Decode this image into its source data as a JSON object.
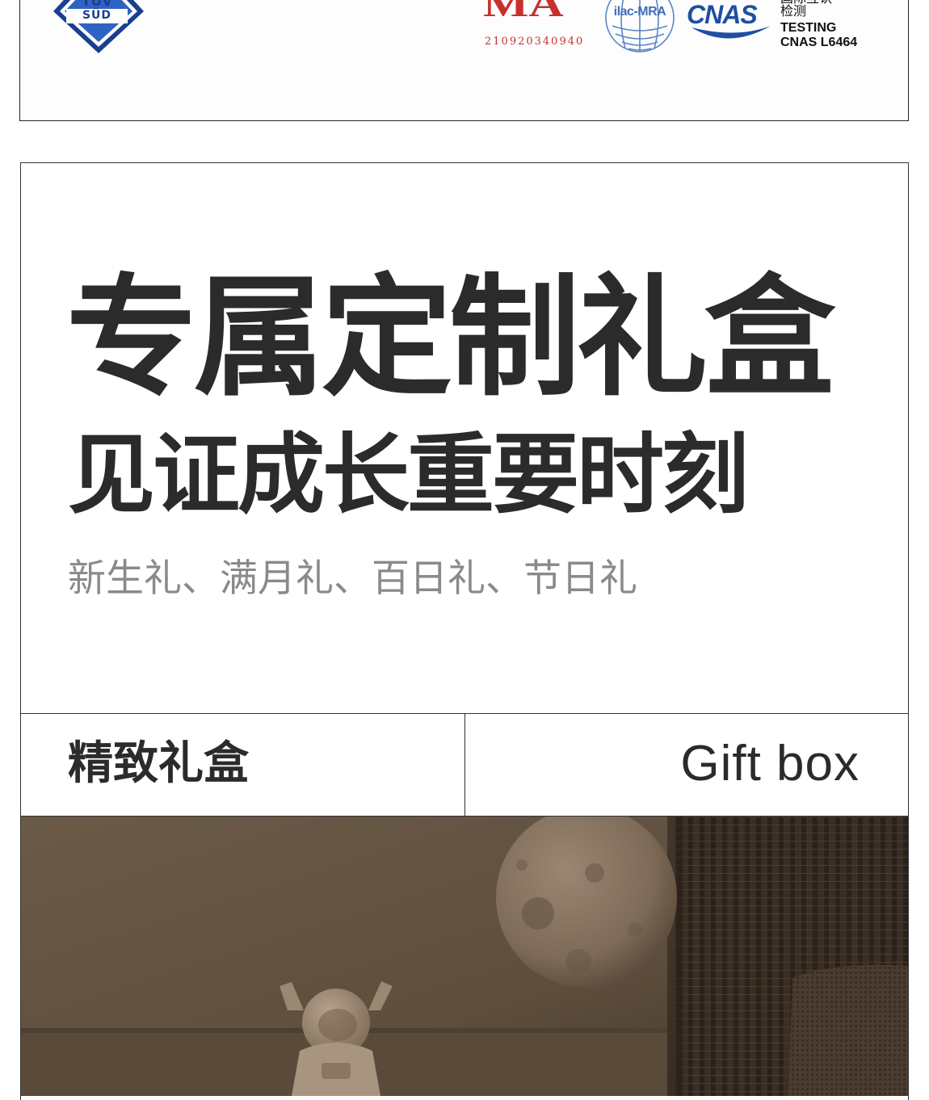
{
  "certifications": {
    "tuv_label": "SÜD",
    "tuv_top": "TÜV",
    "cma_mark": "MA",
    "cma_number": "210920340940",
    "ilac_label": "ilac-MRA",
    "cnas_label": "CNAS",
    "cnas_text_line1": "国际互认",
    "cnas_text_line2": "检测",
    "cnas_text_line3": "TESTING",
    "cnas_text_line4": "CNAS L6464",
    "colors": {
      "tuv_blue": "#1b3f8f",
      "cma_red": "#c8302c",
      "cnas_blue": "#1f4fa1"
    }
  },
  "gift_section": {
    "headline": "专属定制礼盒",
    "subheadline": "见证成长重要时刻",
    "occasions": "新生礼、满月礼、百日礼、节日礼",
    "label_cn": "精致礼盒",
    "label_en": "Gift box"
  },
  "photo": {
    "subject": "astronaut-figurine-with-moon-lamp",
    "palette": {
      "wall": "#6e5e4c",
      "moon": "#8d7a66",
      "curtain": "#3a2e24"
    }
  }
}
